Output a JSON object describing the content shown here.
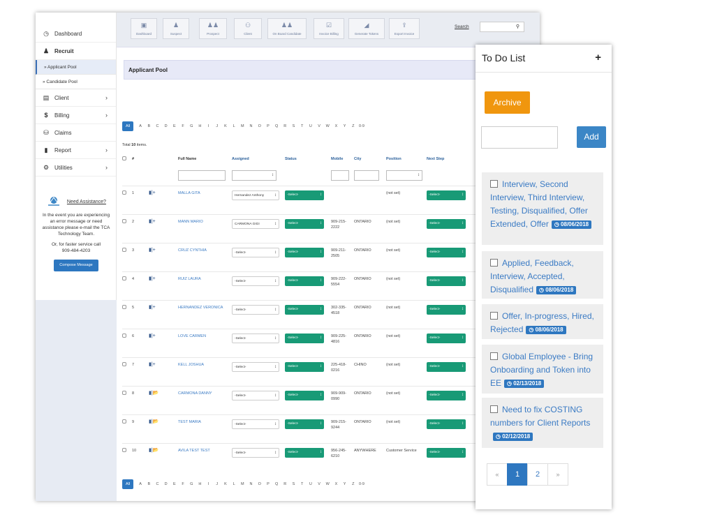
{
  "sidebar": {
    "items": [
      {
        "label": "Dashboard",
        "icon": "dashboard-icon"
      },
      {
        "label": "Recruit",
        "icon": "user-icon"
      },
      {
        "label": "Client",
        "icon": "client-icon"
      },
      {
        "label": "Billing",
        "icon": "dollar-icon"
      },
      {
        "label": "Claims",
        "icon": "claims-icon"
      },
      {
        "label": "Report",
        "icon": "report-icon"
      },
      {
        "label": "Utilities",
        "icon": "utilities-icon"
      }
    ],
    "recruit_sub": [
      "» Applicant Pool",
      "» Candidate Pool"
    ],
    "assist": {
      "link": "Need Assistance?",
      "text": "In the event you are experiencing an error message or need assistance please e-mail the TCA Technology Team.",
      "call": "Or, for faster service call",
      "phone": "909-484-4203",
      "button": "Compose Message"
    }
  },
  "toolbar": {
    "buttons": [
      "Dashboard",
      "Suspect",
      "Prospect",
      "Client",
      "On Board Candidate",
      "Invoice Billing",
      "Generate Tokens",
      "Export Invoice"
    ],
    "search_label": "Search"
  },
  "content": {
    "header": "Applicant Pool",
    "letters": [
      "All",
      "A",
      "B",
      "C",
      "D",
      "E",
      "F",
      "G",
      "H",
      "I",
      "J",
      "K",
      "L",
      "M",
      "N",
      "O",
      "P",
      "Q",
      "R",
      "S",
      "T",
      "U",
      "V",
      "W",
      "X",
      "Y",
      "Z",
      "0-9"
    ],
    "total_prefix": "Total",
    "total_count": "10",
    "total_suffix": "items.",
    "columns": [
      "#",
      "Full Name",
      "Assigned",
      "Status",
      "Mobile",
      "City",
      "Position",
      "Next Step"
    ],
    "select_placeholder": "-Select-",
    "rows": [
      {
        "num": "1",
        "name": "MALLA GITA",
        "assigned": "Hernandez Anthony",
        "mobile": "",
        "city": "",
        "position": "(not set)"
      },
      {
        "num": "2",
        "name": "MANN MARIO",
        "assigned": "CARMONA GIGI",
        "mobile": "909-215-2222",
        "city": "ONTARIO",
        "position": "(not set)"
      },
      {
        "num": "3",
        "name": "CRUZ CYNTHIA",
        "assigned": "-Select-",
        "mobile": "909-211-2505",
        "city": "ONTARIO",
        "position": "(not set)"
      },
      {
        "num": "4",
        "name": "RUIZ LAURA",
        "assigned": "-Select-",
        "mobile": "909-222-5554",
        "city": "ONTARIO",
        "position": "(not set)"
      },
      {
        "num": "5",
        "name": "HERNANDEZ VERONICA",
        "assigned": "-Select-",
        "mobile": "302-335-4518",
        "city": "ONTARIO",
        "position": "(not set)"
      },
      {
        "num": "6",
        "name": "LOVE CARMEN",
        "assigned": "-Select-",
        "mobile": "909-225-4816",
        "city": "ONTARIO",
        "position": "(not set)"
      },
      {
        "num": "7",
        "name": "KELL JOSHUA",
        "assigned": "-Select-",
        "mobile": "225-418-0216",
        "city": "CHINO",
        "position": "(not set)"
      },
      {
        "num": "8",
        "name": "CARMONA DANNY",
        "assigned": "-Select-",
        "mobile": "909-909-0990",
        "city": "ONTARIO",
        "position": "(not set)"
      },
      {
        "num": "9",
        "name": "TEST MARIA",
        "assigned": "-Select-",
        "mobile": "909-215-9244",
        "city": "ONTARIO",
        "position": "(not set)"
      },
      {
        "num": "10",
        "name": "AVILA TEST TEST",
        "assigned": "-Select-",
        "mobile": "956-245-6210",
        "city": "ANYWHERE",
        "position": "Customer Service"
      }
    ]
  },
  "todo": {
    "title": "To Do List",
    "plus": "+",
    "archive": "Archive",
    "add": "Add",
    "items": [
      {
        "text": "Interview, Second Interview, Third Interview, Testing, Disqualified, Offer Extended, Offer",
        "date": "08/06/2018"
      },
      {
        "text": "Applied, Feedback, Interview, Accepted, Disqualified",
        "date": "08/06/2018"
      },
      {
        "text": "Offer, In-progress, Hired, Rejected",
        "date": "08/06/2018"
      },
      {
        "text": "Global Employee - Bring Onboarding and Token into EE",
        "date": "02/13/2018"
      },
      {
        "text": "Need to fix COSTING numbers for Client Reports",
        "date": "02/12/2018"
      }
    ],
    "pager": [
      "«",
      "1",
      "2",
      "»"
    ]
  },
  "colors": {
    "accent": "#2e77c0",
    "archive": "#f0960e",
    "status_green": "#189a76",
    "header_bg": "#e7e9f7"
  }
}
